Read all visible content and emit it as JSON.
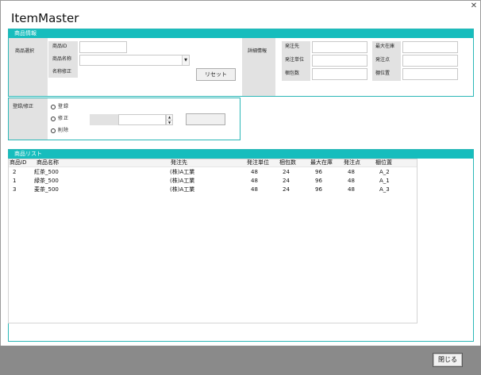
{
  "window": {
    "title": "ItemMaster",
    "close_glyph": "✕"
  },
  "product_info": {
    "header": "商品情報",
    "select_label": "商品選択",
    "product_id_label": "商品ID",
    "product_id_value": "",
    "product_name_label": "商品名称",
    "product_name_value": "",
    "name_edit_label": "名称修正",
    "reset_button": "リセット",
    "detail_label": "詳細情報",
    "supplier_label": "発注先",
    "supplier_value": "",
    "order_unit_label": "発注単位",
    "order_unit_value": "",
    "pack_count_label": "梱包数",
    "pack_count_value": "",
    "max_stock_label": "最大在庫",
    "max_stock_value": "",
    "order_point_label": "発注点",
    "order_point_value": "",
    "shelf_label": "棚位置",
    "shelf_value": ""
  },
  "edit": {
    "label": "登録/修正",
    "options": [
      "登録",
      "修正",
      "削除"
    ],
    "spin_value": "",
    "action_button": ""
  },
  "product_list": {
    "header": "商品リスト",
    "columns": [
      "商品ID",
      "商品名称",
      "発注先",
      "発注単位",
      "梱包数",
      "最大在庫",
      "発注点",
      "棚位置"
    ],
    "rows": [
      [
        "2",
        "紅茶_500",
        "(株)A工業",
        "48",
        "24",
        "96",
        "48",
        "A_2"
      ],
      [
        "1",
        "緑茶_500",
        "(株)A工業",
        "48",
        "24",
        "96",
        "48",
        "A_1"
      ],
      [
        "3",
        "麦茶_500",
        "(株)A工業",
        "48",
        "24",
        "96",
        "48",
        "A_3"
      ]
    ]
  },
  "footer": {
    "close_button": "閉じる"
  },
  "colors": {
    "accent": "#16bdbd",
    "panel_gray": "#e2e2e2",
    "footer": "#8a8a8a"
  }
}
